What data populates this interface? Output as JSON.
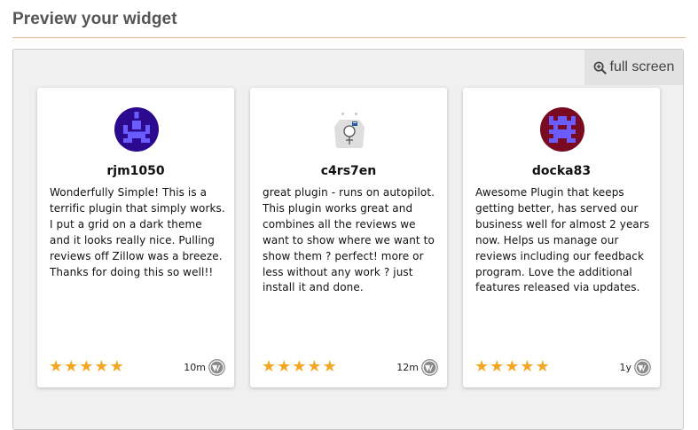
{
  "page": {
    "heading": "Preview your widget"
  },
  "toolbar": {
    "fullscreen_label": "full screen"
  },
  "colors": {
    "star": "#f5a623",
    "accent_rule": "#d9b98a",
    "frame_bg": "#f0f0f0"
  },
  "reviews": [
    {
      "username": "rjm1050",
      "text": "Wonderfully Simple! This is a terrific plugin that simply works. I put a grid on a dark theme and it looks really nice. Pulling reviews off Zillow was a breeze. Thanks for doing this so well!!",
      "rating": 5,
      "time": "10m",
      "source_icon": "wordpress-icon",
      "avatar_color": "#2b0a8f"
    },
    {
      "username": "c4rs7en",
      "text": "great plugin - runs on autopilot. This plugin works great and combines all the reviews we want to show where we want to show them ? perfect! more or less without any work ? just install it and done.",
      "rating": 5,
      "time": "12m",
      "source_icon": "wordpress-icon",
      "avatar_color": "#ffffff"
    },
    {
      "username": "docka83",
      "text": "Awesome Plugin that keeps getting better, has served our business well for almost 2 years now. Helps us manage our reviews including our feedback program. Love the additional features released via updates.",
      "rating": 5,
      "time": "1y",
      "source_icon": "wordpress-icon",
      "avatar_color": "#7a0a22"
    }
  ]
}
